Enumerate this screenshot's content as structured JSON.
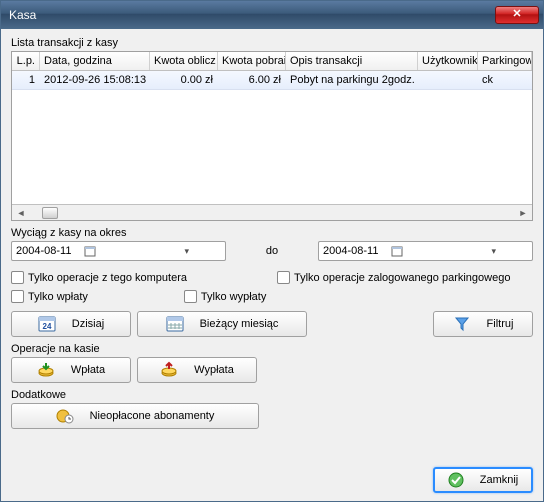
{
  "window": {
    "title": "Kasa"
  },
  "list": {
    "label": "Lista transakcji z kasy",
    "columns": {
      "lp": "L.p.",
      "date": "Data, godzina",
      "kwota1": "Kwota oblicz",
      "kwota2": "Kwota pobrai",
      "opis": "Opis transakcji",
      "user": "Użytkownik",
      "park": "Parkingowy"
    },
    "rows": [
      {
        "lp": "1",
        "date": "2012-09-26 15:08:13",
        "kwota1": "0.00 zł",
        "kwota2": "6.00 zł",
        "opis": "Pobyt na parkingu 2godz.",
        "user": "",
        "park": "ck"
      }
    ]
  },
  "range": {
    "label": "Wyciąg z kasy na okres",
    "from": "2004-08-11",
    "do_label": "do",
    "to": "2004-08-11"
  },
  "checks": {
    "this_pc": "Tylko operacje z tego komputera",
    "logged_park": "Tylko operacje zalogowanego parkingowego",
    "wplaty": "Tylko wpłaty",
    "wyplaty": "Tylko wypłaty"
  },
  "buttons": {
    "today": "Dzisiaj",
    "month": "Bieżący miesiąc",
    "filter": "Filtruj",
    "wplata": "Wpłata",
    "wyplata": "Wypłata",
    "nieop": "Nieopłacone abonamenty",
    "close": "Zamknij"
  },
  "sections": {
    "ops": "Operacje na kasie",
    "extra": "Dodatkowe"
  }
}
